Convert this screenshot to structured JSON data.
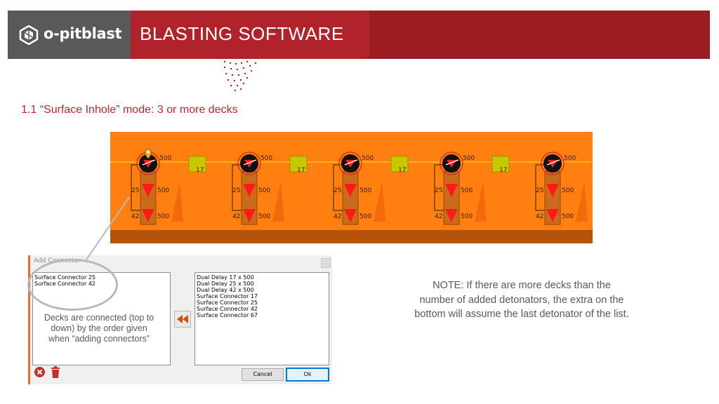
{
  "header": {
    "logo_text": "o-pitblast",
    "title": "BLASTING SOFTWARE"
  },
  "section_title": "1.1 “Surface Inhole” mode: 3 or more decks",
  "canvas": {
    "top_delay_label": "500",
    "surface_connector_label": "17",
    "deck_labels": [
      "25",
      "42"
    ],
    "deck_delay_label": "500",
    "hole_count": 5
  },
  "dialog": {
    "title": "Add Connector",
    "left_items": [
      "Surface Connector 25",
      "Surface Connector 42"
    ],
    "right_items": [
      "Dual Delay 17 x 500",
      "Dual Delay 25 x 500",
      "Dual Delay 42 x 500",
      "Surface Connector 17",
      "Surface Connector 25",
      "Surface Connector 42",
      "Surface Connector 67"
    ],
    "cancel_label": "Cancel",
    "ok_label": "Ok",
    "move_icon": "double-chevron-left-icon",
    "remove_icon": "close-circle-icon",
    "delete_icon": "trash-icon"
  },
  "left_note": "Decks are connected (top to down) by the order given when “adding connectors”",
  "note": "NOTE: If there are more decks than the number of added detonators, the extra on the bottom will assume the last detonator of the list.",
  "colors": {
    "brand_red": "#9b1c22",
    "accent_red": "#c0272d",
    "logo_gray": "#595959",
    "canvas_orange": "#ff8010"
  }
}
